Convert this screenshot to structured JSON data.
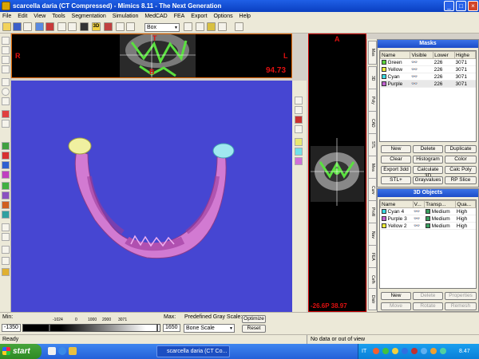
{
  "window": {
    "title": "scarcella daria (CT Compressed) - Mimics  8.11 - The Next Generation"
  },
  "menu": [
    "File",
    "Edit",
    "View",
    "Tools",
    "Segmentation",
    "Simulation",
    "MedCAD",
    "FEA",
    "Export",
    "Options",
    "Help"
  ],
  "toolbar": {
    "zoom_select": "Box"
  },
  "views": {
    "axial": {
      "label_top": "T",
      "label_bottom": "B",
      "label_left": "R",
      "label_right": "L",
      "readout": "94.73"
    },
    "sagittal": {
      "label_top": "A",
      "readout": "-26.6P 38.97"
    }
  },
  "masks_panel": {
    "title": "Masks",
    "columns": [
      "Name",
      "Visible",
      "Lower",
      "Highe"
    ],
    "rows": [
      {
        "name": "Green",
        "lower": "226",
        "higher": "3071",
        "color": "#5ad23c"
      },
      {
        "name": "Yellow",
        "lower": "226",
        "higher": "3071",
        "color": "#ecec3a"
      },
      {
        "name": "Cyan",
        "lower": "226",
        "higher": "3071",
        "color": "#3ad8e0"
      },
      {
        "name": "Purple",
        "lower": "226",
        "higher": "3071",
        "color": "#c060d0"
      }
    ],
    "buttons": [
      "New",
      "Delete",
      "Duplicate",
      "Clear",
      "Histogram",
      "Color",
      "Export 3dd",
      "Calculate 3D",
      "Calc Poly",
      "STL+",
      "Grayvalues",
      "RP Slice"
    ]
  },
  "objects_panel": {
    "title": "3D Objects",
    "columns": [
      "Name",
      "V...",
      "Transp...",
      "Qua..."
    ],
    "rows": [
      {
        "name": "Cyan 4",
        "transp": "Medium",
        "quality": "High",
        "color": "#3ad8e0"
      },
      {
        "name": "Purple 3",
        "transp": "Medium",
        "quality": "High",
        "color": "#c060d0"
      },
      {
        "name": "Yellow 2",
        "transp": "Medium",
        "quality": "High",
        "color": "#ecec3a"
      }
    ],
    "buttons": [
      {
        "label": "New",
        "enabled": true
      },
      {
        "label": "Delete",
        "enabled": false
      },
      {
        "label": "Properties",
        "enabled": false
      },
      {
        "label": "Move",
        "enabled": false
      },
      {
        "label": "Rotate",
        "enabled": false
      },
      {
        "label": "Remesh",
        "enabled": false
      }
    ]
  },
  "side_tabs": [
    "Mas",
    "3D",
    "Poly",
    "CAD",
    "STL",
    "Mea",
    "Curv",
    "Profil",
    "Nav",
    "FEA",
    "Cefh",
    "Distr"
  ],
  "bottom": {
    "min_label": "Min:",
    "min_value": "-1350",
    "ticks": [
      "-1024",
      "0",
      "1000",
      "2000",
      "3071"
    ],
    "max_label": "Max:",
    "max_value": "1650",
    "gray_scale_label": "Predefined Gray Scale:",
    "gray_scale_value": "Bone Scale",
    "optimize_label": "Optimize",
    "reset_label": "Reset"
  },
  "status": {
    "left": "Ready",
    "right": "No data or out of view"
  },
  "taskbar": {
    "start": "start",
    "task": "scarcella daria (CT Co...",
    "lang": "IT",
    "clock": "8.47"
  }
}
